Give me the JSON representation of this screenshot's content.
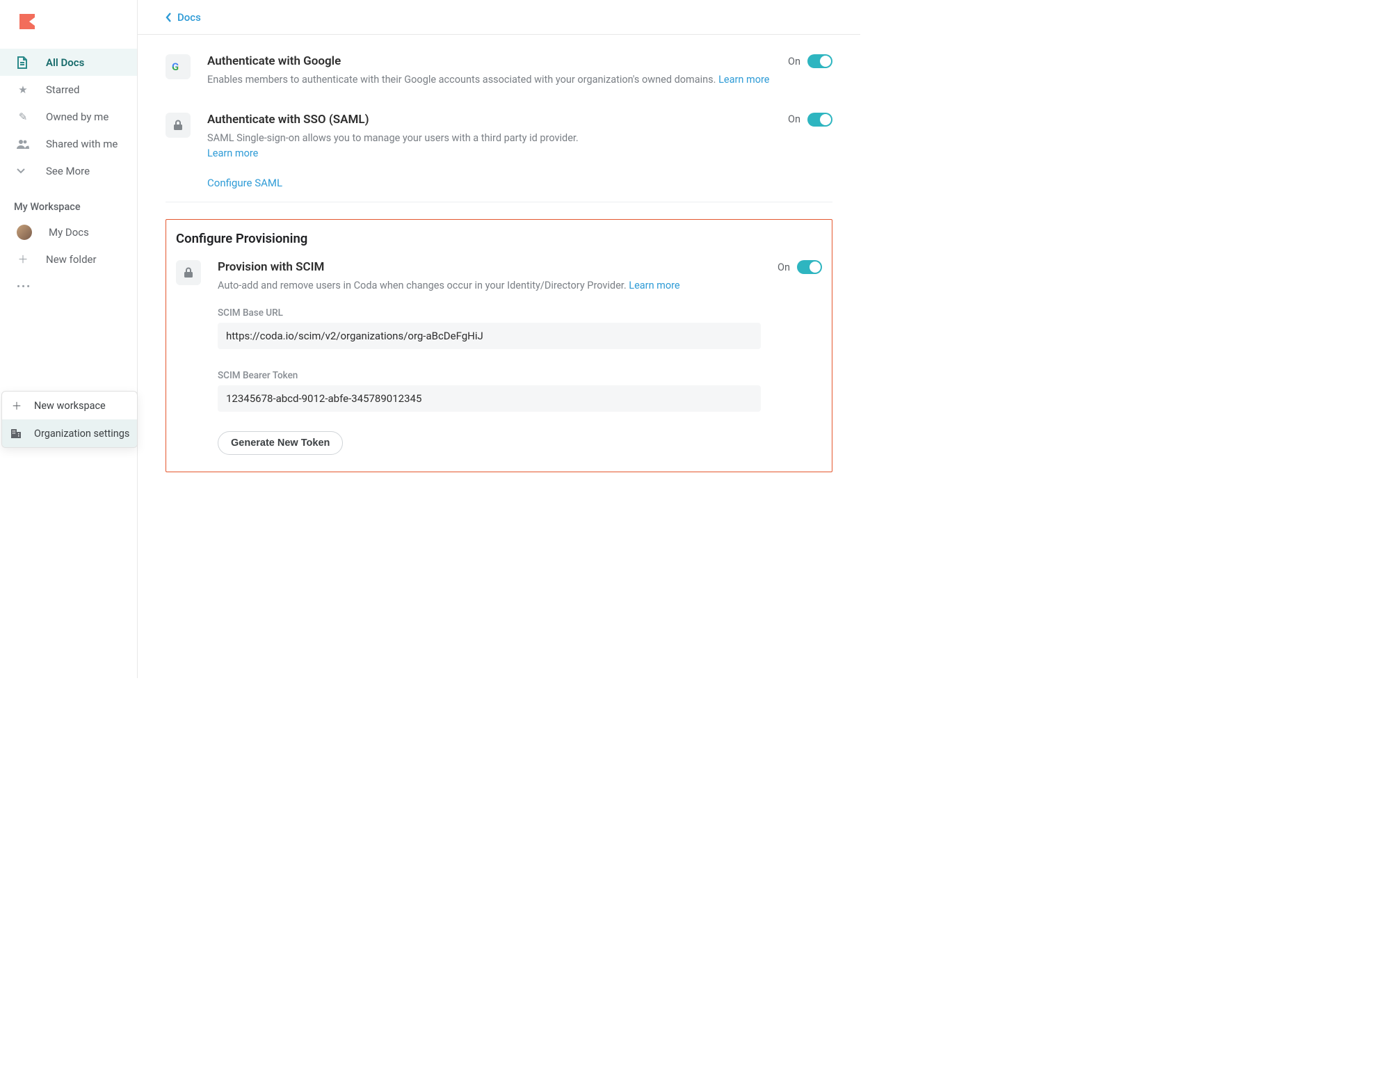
{
  "breadcrumb": {
    "label": "Docs"
  },
  "sidebar": {
    "items": [
      {
        "label": "All Docs"
      },
      {
        "label": "Starred"
      },
      {
        "label": "Owned by me"
      },
      {
        "label": "Shared with me"
      },
      {
        "label": "See More"
      }
    ],
    "workspace_heading": "My Workspace",
    "workspace_items": [
      {
        "label": "My Docs"
      },
      {
        "label": "New folder"
      }
    ]
  },
  "popup": {
    "new_workspace": "New workspace",
    "org_settings": "Organization settings"
  },
  "settings": {
    "google": {
      "title": "Authenticate with Google",
      "desc": "Enables members to authenticate with their Google accounts associated with your organization's owned domains. ",
      "learn": "Learn more",
      "state": "On"
    },
    "sso": {
      "title": "Authenticate with SSO (SAML)",
      "desc": "SAML Single-sign-on allows you to manage your users with a third party id provider. ",
      "learn": "Learn more",
      "configure": "Configure SAML",
      "state": "On"
    }
  },
  "provisioning": {
    "heading": "Configure Provisioning",
    "scim": {
      "title": "Provision with SCIM",
      "desc": "Auto-add and remove users in Coda when changes occur in your Identity/Directory Provider. ",
      "learn": "Learn more",
      "state": "On",
      "url_label": "SCIM Base URL",
      "url_value": "https://coda.io/scim/v2/organizations/org-aBcDeFgHiJ",
      "token_label": "SCIM Bearer Token",
      "token_value": "12345678-abcd-9012-abfe-345789012345",
      "generate": "Generate New Token"
    }
  }
}
